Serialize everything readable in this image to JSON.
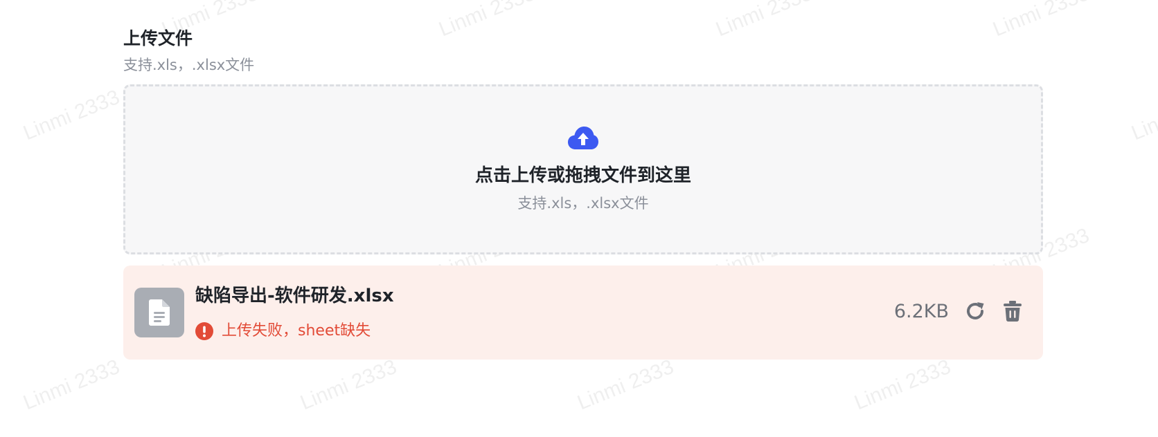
{
  "watermark": {
    "text": "Linmi 2333"
  },
  "upload": {
    "title": "上传文件",
    "subtitle": "支持.xls，.xlsx文件",
    "dropzone": {
      "icon": "cloud-upload-icon",
      "text": "点击上传或拖拽文件到这里",
      "hint": "支持.xls，.xlsx文件",
      "accent_color": "#3d5af1"
    }
  },
  "file": {
    "name": "缺陷导出-软件研发.xlsx",
    "size": "6.2KB",
    "status": "error",
    "error_message": "上传失败，sheet缺失",
    "error_color": "#e24b37",
    "background_color": "#fdefeb",
    "icons": {
      "thumb": "document-icon",
      "error": "alert-circle-icon",
      "retry": "refresh-icon",
      "delete": "trash-icon"
    }
  }
}
